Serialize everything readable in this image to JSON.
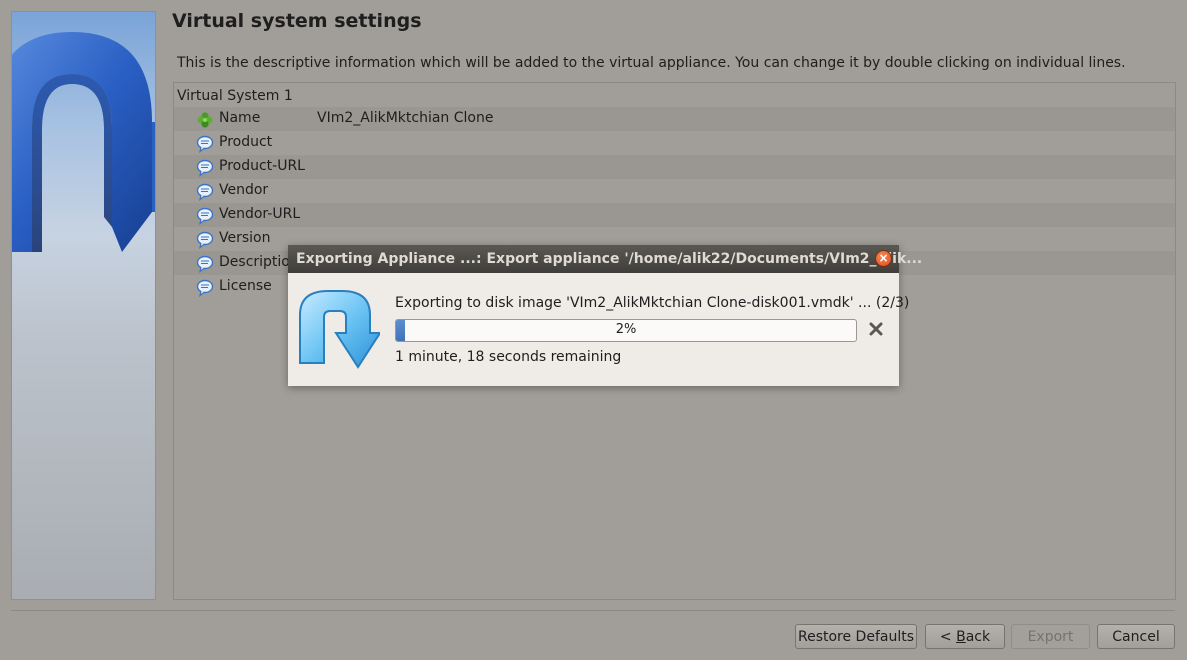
{
  "page": {
    "title": "Virtual system settings",
    "description": "This is the descriptive information which will be added to the virtual appliance. You can change it by double clicking on individual lines."
  },
  "tree": {
    "root": "Virtual System 1",
    "rows": [
      {
        "key": "Name",
        "value": "VIm2_AlikMktchian Clone",
        "icon": "name-clover-icon"
      },
      {
        "key": "Product",
        "value": "",
        "icon": "speech-bubble-icon"
      },
      {
        "key": "Product-URL",
        "value": "",
        "icon": "speech-bubble-icon"
      },
      {
        "key": "Vendor",
        "value": "",
        "icon": "speech-bubble-icon"
      },
      {
        "key": "Vendor-URL",
        "value": "",
        "icon": "speech-bubble-icon"
      },
      {
        "key": "Version",
        "value": "",
        "icon": "speech-bubble-icon"
      },
      {
        "key": "Description",
        "value": "",
        "icon": "speech-bubble-icon"
      },
      {
        "key": "License",
        "value": "",
        "icon": "speech-bubble-icon"
      }
    ]
  },
  "buttons": {
    "restore": "Restore Defaults",
    "back_prefix": "< ",
    "back_mnemonic": "B",
    "back_rest": "ack",
    "export": "Export",
    "cancel": "Cancel"
  },
  "dialog": {
    "title": "Exporting Appliance ...: Export appliance '/home/alik22/Documents/VIm2_Alik...",
    "message": "Exporting to disk image 'VIm2_AlikMktchian Clone-disk001.vmdk' ... (2/3)",
    "progress_percent": 2,
    "progress_label": "2%",
    "remaining": "1 minute, 18 seconds remaining",
    "close_glyph": "×"
  },
  "colors": {
    "background": "#a19e99",
    "dialog_title": "#3f3e3a",
    "dialog_body": "#efebe7",
    "progress_fill": "#4a7fc4",
    "close_button": "#df4a16"
  }
}
